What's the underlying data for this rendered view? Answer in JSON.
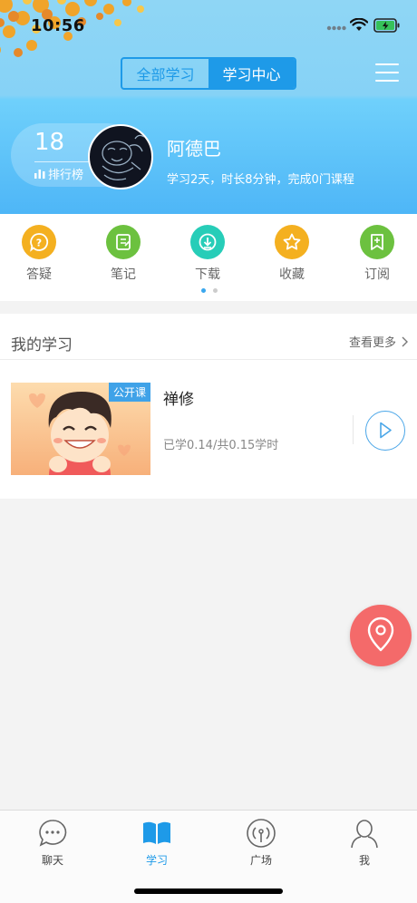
{
  "status_bar": {
    "time": "10:56"
  },
  "header": {
    "segment": [
      {
        "label": "全部学习",
        "active": false
      },
      {
        "label": "学习中心",
        "active": true
      }
    ],
    "rank": {
      "number": "18",
      "label": "排行榜"
    },
    "user": {
      "name": "阿德巴",
      "stats": "学习2天，时长8分钟，完成0门课程"
    }
  },
  "actions": [
    {
      "label": "答疑",
      "icon": "question-bubble-icon",
      "color": "#f4b020"
    },
    {
      "label": "笔记",
      "icon": "notebook-icon",
      "color": "#6cc13f"
    },
    {
      "label": "下载",
      "icon": "download-icon",
      "color": "#27cdb8"
    },
    {
      "label": "收藏",
      "icon": "star-icon",
      "color": "#f4b020"
    },
    {
      "label": "订阅",
      "icon": "subscribe-icon",
      "color": "#6cc13f"
    }
  ],
  "my_learning": {
    "title": "我的学习",
    "more": "查看更多",
    "course": {
      "tag": "公开课",
      "name": "禅修",
      "progress": "已学0.14/共0.15学时"
    }
  },
  "tabbar": [
    {
      "label": "聊天",
      "icon": "chat-icon",
      "active": false
    },
    {
      "label": "学习",
      "icon": "book-icon",
      "active": true
    },
    {
      "label": "广场",
      "icon": "broadcast-icon",
      "active": false
    },
    {
      "label": "我",
      "icon": "person-icon",
      "active": false
    }
  ],
  "colors": {
    "accent": "#1e9ae8",
    "fab": "#f46a6a"
  }
}
